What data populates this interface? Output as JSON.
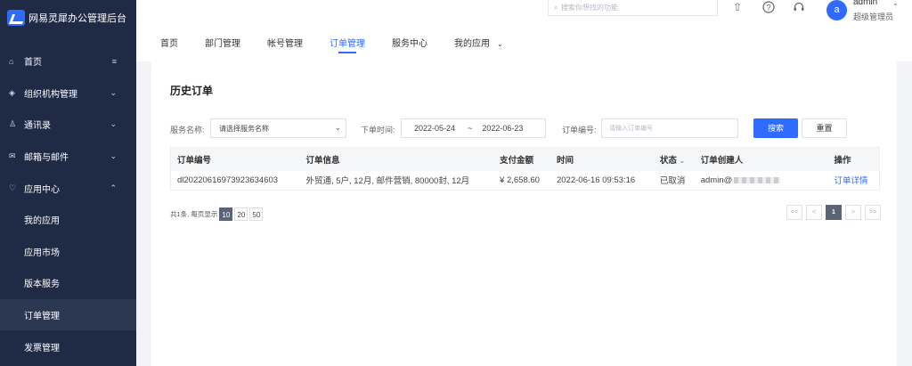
{
  "brand": {
    "title": "网易灵犀办公管理后台"
  },
  "sidebar": {
    "items": [
      {
        "icon": "home-icon",
        "glyph": "⌂",
        "label": "首页",
        "arrow": "≡"
      },
      {
        "icon": "org-icon",
        "glyph": "◈",
        "label": "组织机构管理",
        "arrow": "⌄"
      },
      {
        "icon": "contacts-icon",
        "glyph": "♙",
        "label": "通讯录",
        "arrow": "⌄"
      },
      {
        "icon": "mail-icon",
        "glyph": "✉",
        "label": "邮箱与邮件",
        "arrow": "⌄"
      },
      {
        "icon": "apps-icon",
        "glyph": "♡",
        "label": "应用中心",
        "arrow": "⌃"
      }
    ],
    "sub_items": [
      "我的应用",
      "应用市场",
      "版本服务",
      "订单管理",
      "发票管理"
    ],
    "active_sub": "订单管理"
  },
  "topbar": {
    "search_placeholder": "搜索你想找的功能",
    "user": {
      "avatar": "a",
      "name": "admin",
      "role": "超级管理员"
    }
  },
  "tabs": [
    "首页",
    "部门管理",
    "帐号管理",
    "订单管理",
    "服务中心",
    "我的应用"
  ],
  "active_tab": "订单管理",
  "page": {
    "title": "历史订单",
    "filters": {
      "service_label": "服务名称:",
      "service_placeholder": "请选择服务名称",
      "date_label": "下单时间:",
      "date_start": "2022-05-24",
      "date_sep": "~",
      "date_end": "2022-06-23",
      "order_label": "订单编号:",
      "order_placeholder": "请输入订单编号",
      "search_button": "搜索",
      "reset_button": "重置"
    },
    "table": {
      "headers": [
        "订单编号",
        "订单信息",
        "支付金额",
        "时间",
        "状态",
        "订单创建人",
        "操作"
      ],
      "rows": [
        {
          "order_id": "dl20220616973923634603",
          "info": "外贸通, 5户, 12月, 邮件营销, 80000封, 12月",
          "amount": "¥ 2,658.60",
          "time": "2022-06-16 09:53:16",
          "status": "已取消",
          "creator": "admin@",
          "action": "订单详情"
        }
      ]
    },
    "pagination": {
      "total_text": "共1条, 每页显示",
      "page_sizes": [
        "10",
        "20",
        "50"
      ],
      "current_size": "10",
      "first": "<<",
      "prev": "<",
      "current_page": "1",
      "next": ">",
      "last": ">>"
    }
  },
  "colors": {
    "sidebar_bg": "#1f2a44",
    "primary": "#2f6bff",
    "page_bg": "#f2f3f7"
  }
}
